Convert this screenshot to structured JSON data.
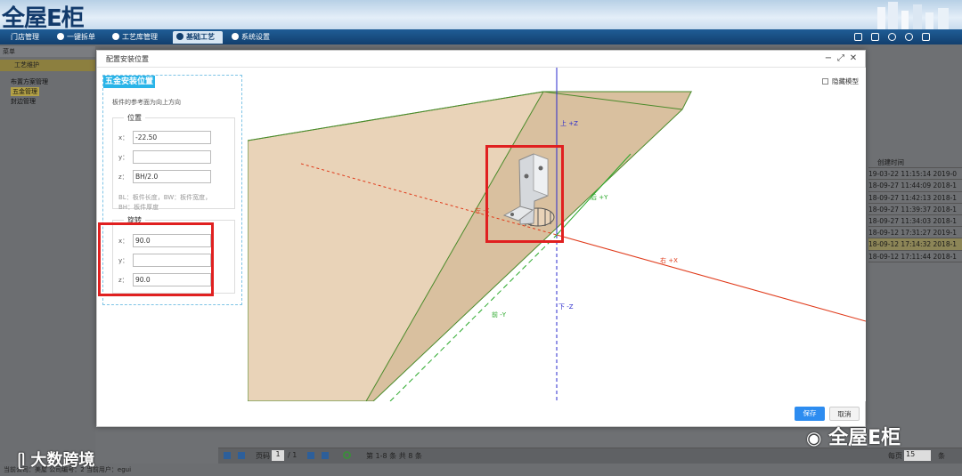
{
  "app": {
    "logo": "全屋E柜"
  },
  "nav": {
    "tabs": [
      {
        "label": "门店管理"
      },
      {
        "label": "一键拆单"
      },
      {
        "label": "工艺库管理"
      },
      {
        "label": "基础工艺",
        "active": true
      },
      {
        "label": "系统设置"
      }
    ],
    "tools": [
      "home-icon",
      "calendar-icon",
      "user-icon",
      "gear-icon",
      "exit-icon"
    ]
  },
  "sidebar": {
    "header": "菜单",
    "section": "工艺维护",
    "items": [
      {
        "label": "布置方案管理"
      },
      {
        "label": "五金管理",
        "selected": true
      },
      {
        "label": "封边管理"
      }
    ]
  },
  "table": {
    "header": "创建时间",
    "rows": [
      {
        "time": "19-03-22 11:15:14",
        "next": "2019-0"
      },
      {
        "time": "18-09-27 11:44:09",
        "next": "2018-1"
      },
      {
        "time": "18-09-27 11:42:13",
        "next": "2018-1"
      },
      {
        "time": "18-09-27 11:39:37",
        "next": "2018-1"
      },
      {
        "time": "18-09-27 11:34:03",
        "next": "2018-1"
      },
      {
        "time": "18-09-12 17:31:27",
        "next": "2019-1"
      },
      {
        "time": "18-09-12 17:14:32",
        "next": "2018-1",
        "highlight": true
      },
      {
        "time": "18-09-12 17:11:44",
        "next": "2018-1"
      }
    ]
  },
  "pager": {
    "page_label": "页码",
    "page_value": "1",
    "page_total": "/ 1",
    "summary": "第 1-8 条  共 8 条",
    "per_page_label": "每页",
    "per_page": "15",
    "unit": "条"
  },
  "status": {
    "text": "当前公司：美屋  公司编号：2  当前用户：egui"
  },
  "modal": {
    "title": "配置安装位置",
    "panel_title": "五金安装位置",
    "panel_desc": "板件的参考面为向上方向",
    "position": {
      "legend": "位置",
      "x_label": "x：",
      "x_value": "-22.50",
      "y_label": "y：",
      "y_value": "",
      "z_label": "z：",
      "z_value": "BH/2.0",
      "hint": "BL：板件长度，BW：板件宽度，BH：板件厚度"
    },
    "rotation": {
      "legend": "旋转",
      "x_label": "x：",
      "x_value": "90.0",
      "y_label": "y：",
      "y_value": "",
      "z_label": "z：",
      "z_value": "90.0"
    },
    "hide_model": "隐藏模型",
    "save": "保存",
    "cancel": "取消",
    "axes": {
      "up": "上 +Z",
      "down": "下 -Z",
      "left": "左 -X",
      "right": "右 +X",
      "front": "前 -Y",
      "back": "后 +Y"
    }
  },
  "watermarks": {
    "left": "大数跨境",
    "right": "全屋E柜"
  },
  "colors": {
    "accent": "#29b4e8",
    "highlight_red": "#e02020",
    "board": "#e9d3b8",
    "save_blue": "#2d8cf0"
  }
}
